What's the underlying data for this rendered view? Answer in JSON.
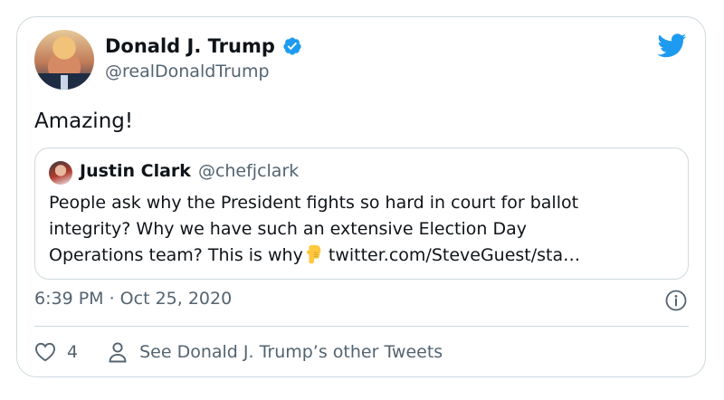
{
  "author": {
    "display_name": "Donald J. Trump",
    "handle": "@realDonaldTrump",
    "verified": true
  },
  "tweet": {
    "text": "Amazing!",
    "timestamp": "6:39 PM · Oct 25, 2020"
  },
  "quoted_tweet": {
    "display_name": "Justin Clark",
    "handle": "@chefjclark",
    "lines": [
      "People ask why the President fights so hard in court for ballot",
      "integrity?  Why we have such an extensive Election Day",
      "Operations team? This is why"
    ],
    "emoji": "pointing-down-hand",
    "link": "twitter.com/SteveGuest/sta…"
  },
  "actions": {
    "like_count": "4",
    "other_tweets_label": "See Donald J. Trump’s other Tweets"
  },
  "colors": {
    "twitter_blue": "#1d9bf0",
    "secondary_text": "#536471",
    "border": "#cfd9de"
  },
  "icons": {
    "brand": "twitter-bird-icon",
    "verified": "verified-badge-icon",
    "info": "info-icon",
    "like": "heart-icon",
    "profile": "person-icon"
  }
}
